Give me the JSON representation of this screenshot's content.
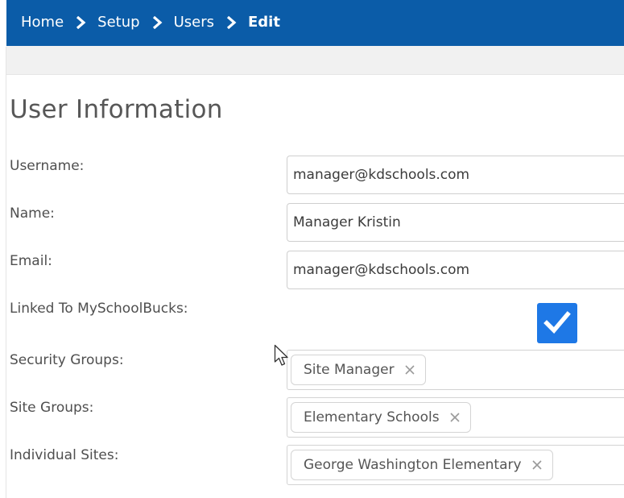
{
  "breadcrumb": {
    "items": [
      "Home",
      "Setup",
      "Users"
    ],
    "current": "Edit"
  },
  "page": {
    "title": "User Information"
  },
  "form": {
    "username": {
      "label": "Username:",
      "value": "manager@kdschools.com"
    },
    "name": {
      "label": "Name:",
      "value": "Manager Kristin"
    },
    "email": {
      "label": "Email:",
      "value": "manager@kdschools.com"
    },
    "linked": {
      "label": "Linked To MySchoolBucks:",
      "checked": true
    },
    "security_groups": {
      "label": "Security Groups:",
      "tags": [
        "Site Manager"
      ]
    },
    "site_groups": {
      "label": "Site Groups:",
      "tags": [
        "Elementary Schools"
      ]
    },
    "individual_sites": {
      "label": "Individual Sites:",
      "tags": [
        "George Washington Elementary"
      ]
    }
  },
  "icons": {
    "breadcrumb_separator": "chevron-right-icon",
    "tag_remove": "close-icon",
    "checkbox_mark": "checkmark-icon",
    "pointer": "mouse-cursor-icon"
  },
  "colors": {
    "header_bg": "#0b5ca8",
    "checkbox_bg": "#1e78e6",
    "toolbar_bg": "#f1f1f1",
    "title_text": "#575757"
  }
}
